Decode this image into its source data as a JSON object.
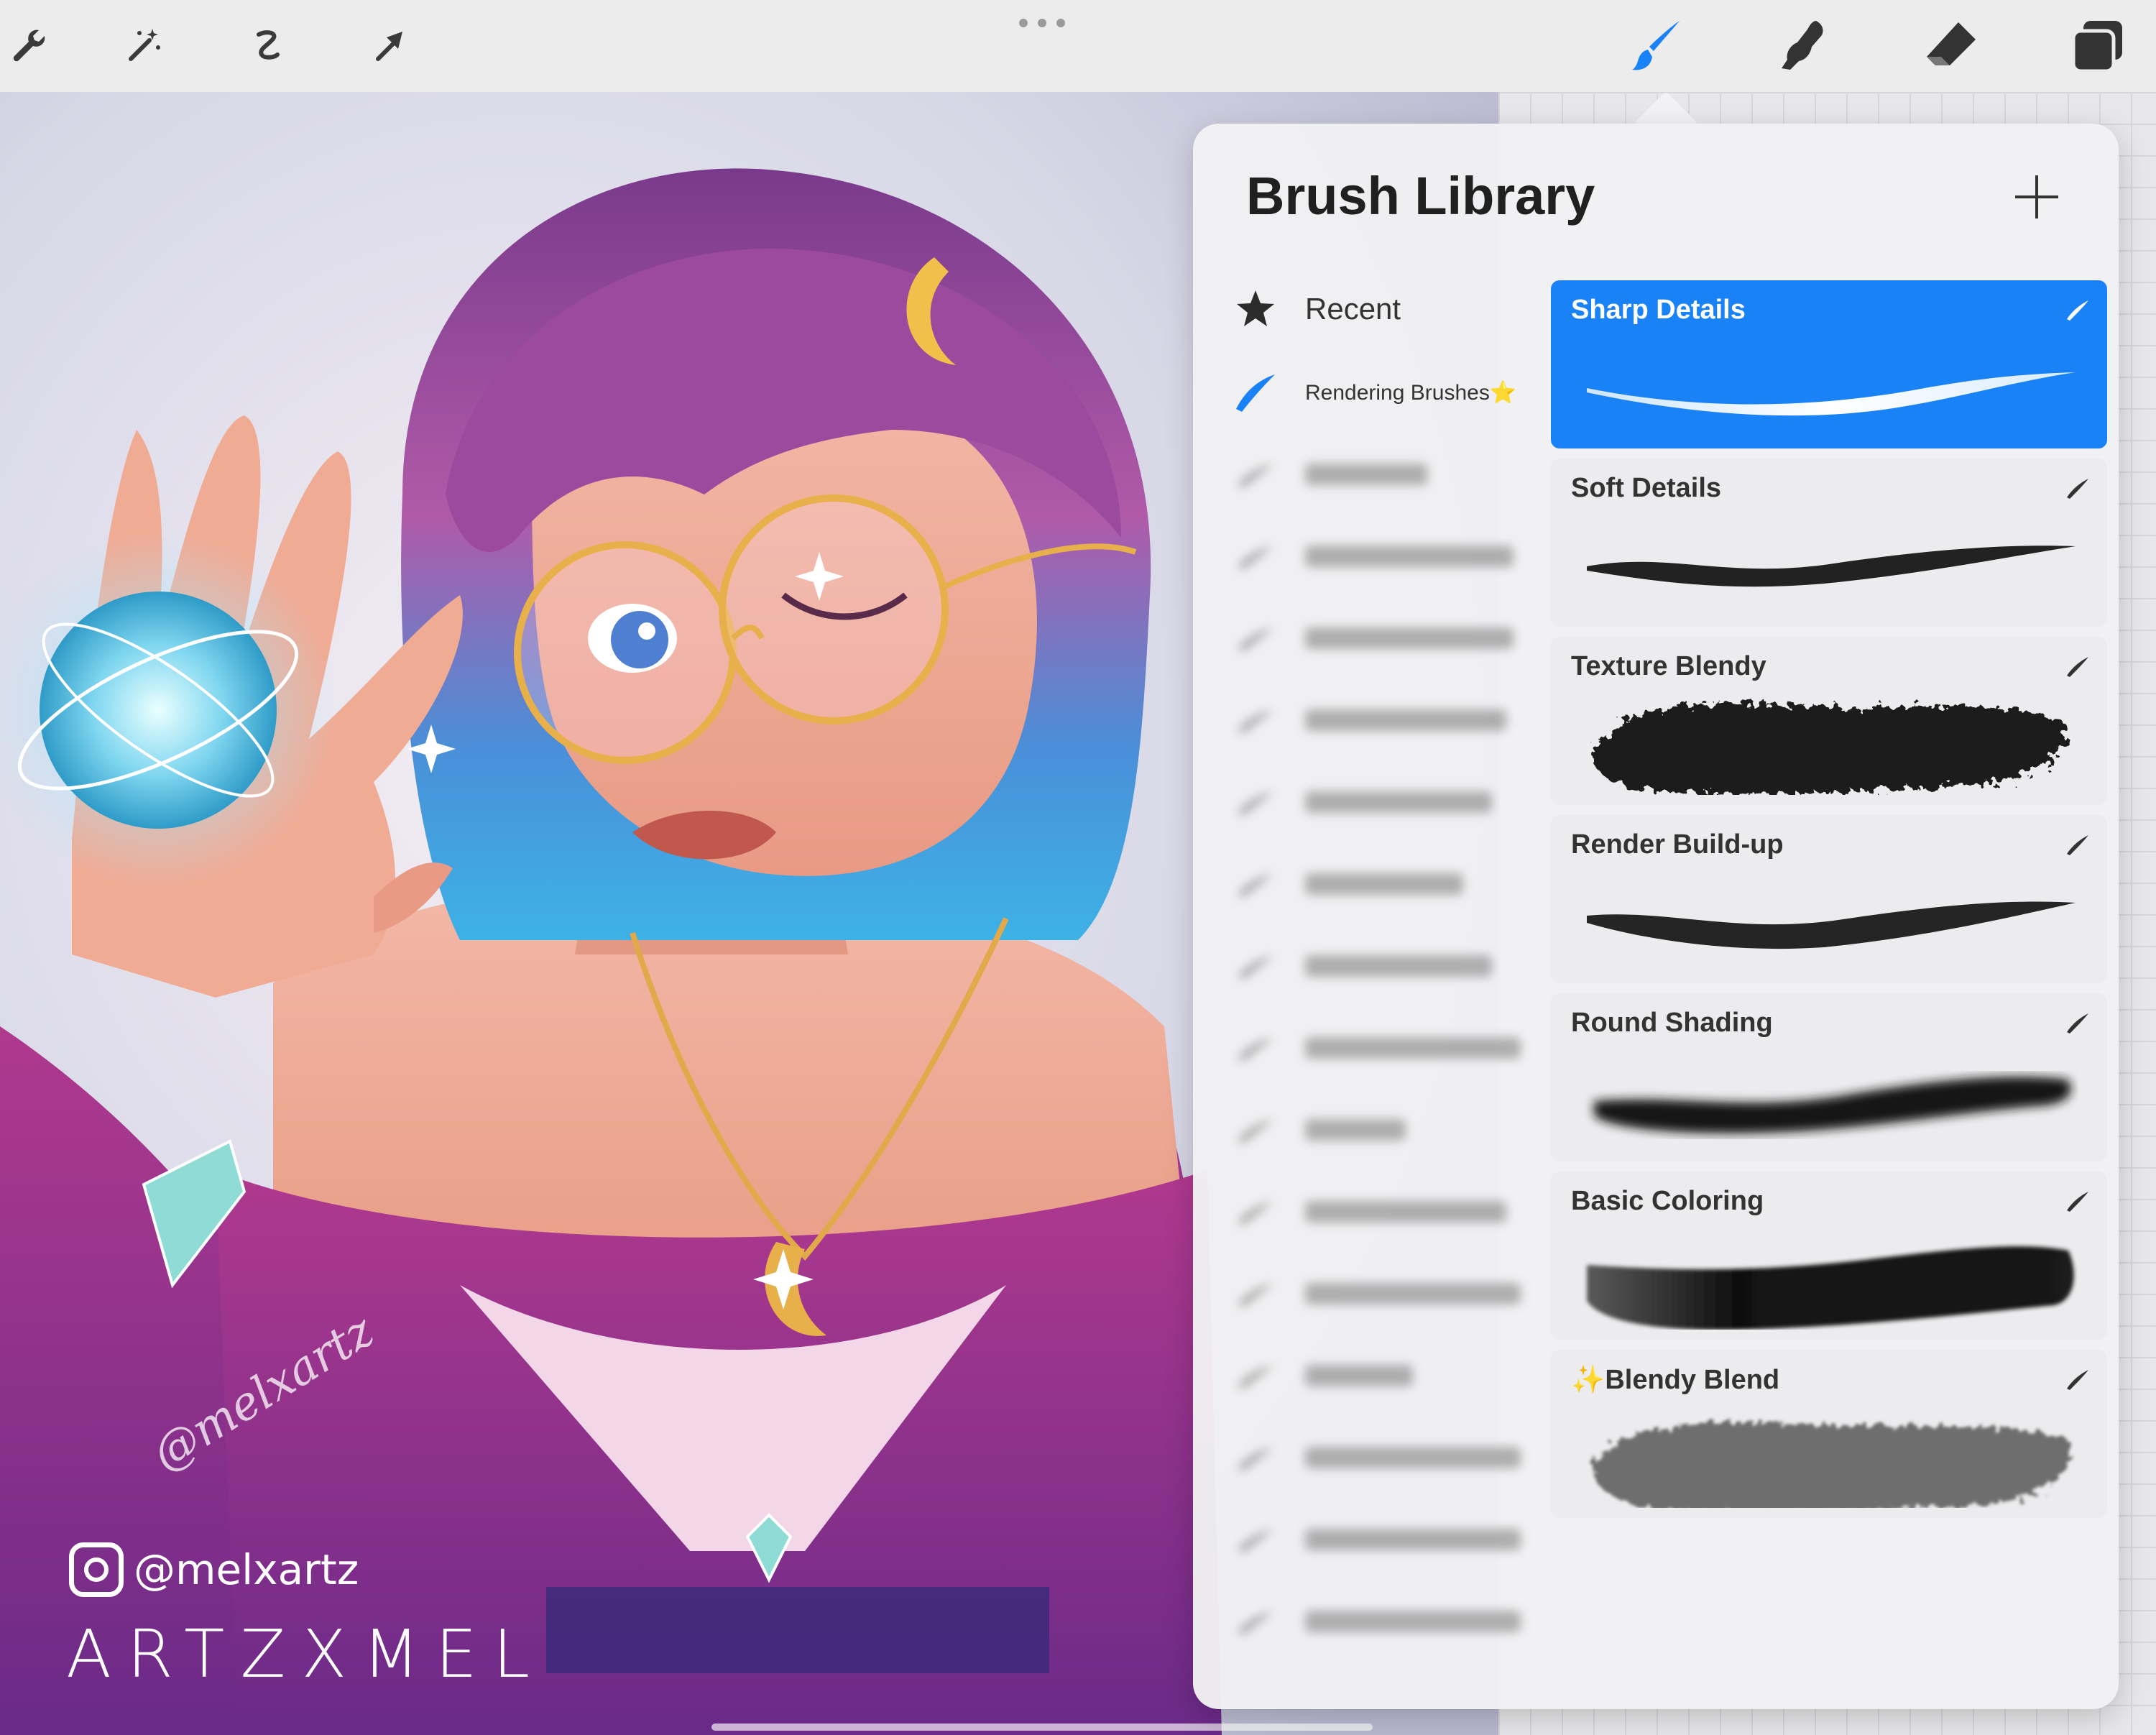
{
  "toolbar": {
    "left_tools": [
      "wrench-icon",
      "magic-wand-icon",
      "selection-icon",
      "transform-arrow-icon"
    ],
    "right_tools": [
      "brush-icon",
      "smudge-icon",
      "eraser-icon",
      "layers-icon"
    ],
    "active_tool": "brush-icon",
    "accent_color": "#1a82f7"
  },
  "canvas": {
    "watermark_handle": "@melxartz",
    "watermark_brand": "ARTZXMEL",
    "signature_text": "@melxartz"
  },
  "brush_library": {
    "title": "Brush Library",
    "add_label": "+",
    "sets": [
      {
        "label": "Recent",
        "icon": "star-icon"
      },
      {
        "label": "Rendering Brushes⭐",
        "icon": "brush-stroke-icon"
      }
    ],
    "brushes": [
      {
        "name": "Sharp Details",
        "selected": true
      },
      {
        "name": "Soft Details",
        "selected": false
      },
      {
        "name": "Texture Blendy",
        "selected": false
      },
      {
        "name": "Render Build-up",
        "selected": false
      },
      {
        "name": "Round Shading",
        "selected": false
      },
      {
        "name": "Basic Coloring",
        "selected": false
      },
      {
        "name": "✨Blendy Blend",
        "selected": false
      }
    ]
  }
}
